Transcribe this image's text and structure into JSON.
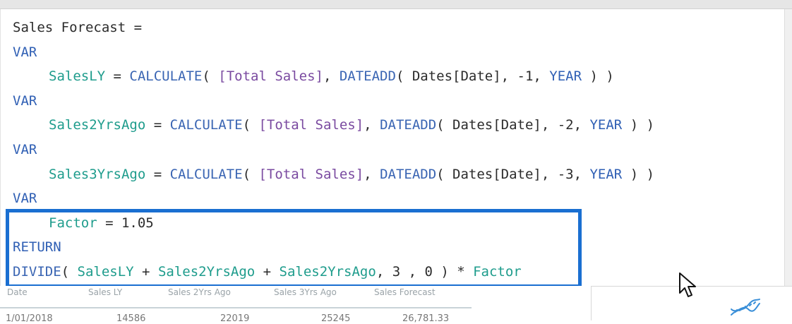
{
  "editor": {
    "lines": [
      {
        "tokens": [
          {
            "t": "Sales Forecast =",
            "c": "plain"
          }
        ]
      },
      {
        "tokens": [
          {
            "t": "VAR",
            "c": "kw"
          }
        ]
      },
      {
        "indent": true,
        "tokens": [
          {
            "t": "SalesLY",
            "c": "var"
          },
          {
            "t": " = ",
            "c": "plain"
          },
          {
            "t": "CALCULATE",
            "c": "fn"
          },
          {
            "t": "( ",
            "c": "plain"
          },
          {
            "t": "[Total Sales]",
            "c": "meas"
          },
          {
            "t": ", ",
            "c": "plain"
          },
          {
            "t": "DATEADD",
            "c": "fn"
          },
          {
            "t": "( Dates[Date], -1, ",
            "c": "plain"
          },
          {
            "t": "YEAR",
            "c": "kw"
          },
          {
            "t": " ) )",
            "c": "plain"
          }
        ]
      },
      {
        "tokens": [
          {
            "t": "VAR",
            "c": "kw"
          }
        ]
      },
      {
        "indent": true,
        "tokens": [
          {
            "t": "Sales2YrsAgo",
            "c": "var"
          },
          {
            "t": " = ",
            "c": "plain"
          },
          {
            "t": "CALCULATE",
            "c": "fn"
          },
          {
            "t": "( ",
            "c": "plain"
          },
          {
            "t": "[Total Sales]",
            "c": "meas"
          },
          {
            "t": ", ",
            "c": "plain"
          },
          {
            "t": "DATEADD",
            "c": "fn"
          },
          {
            "t": "( Dates[Date], -2, ",
            "c": "plain"
          },
          {
            "t": "YEAR",
            "c": "kw"
          },
          {
            "t": " ) )",
            "c": "plain"
          }
        ]
      },
      {
        "tokens": [
          {
            "t": "VAR",
            "c": "kw"
          }
        ]
      },
      {
        "indent": true,
        "tokens": [
          {
            "t": "Sales3YrsAgo",
            "c": "var"
          },
          {
            "t": " = ",
            "c": "plain"
          },
          {
            "t": "CALCULATE",
            "c": "fn"
          },
          {
            "t": "( ",
            "c": "plain"
          },
          {
            "t": "[Total Sales]",
            "c": "meas"
          },
          {
            "t": ", ",
            "c": "plain"
          },
          {
            "t": "DATEADD",
            "c": "fn"
          },
          {
            "t": "( Dates[Date], -3, ",
            "c": "plain"
          },
          {
            "t": "YEAR",
            "c": "kw"
          },
          {
            "t": " ) )",
            "c": "plain"
          }
        ]
      },
      {
        "tokens": [
          {
            "t": "VAR",
            "c": "kw"
          }
        ]
      },
      {
        "indent": true,
        "tokens": [
          {
            "t": "Factor",
            "c": "var"
          },
          {
            "t": " = 1.05",
            "c": "plain"
          }
        ]
      },
      {
        "tokens": [
          {
            "t": "RETURN",
            "c": "kw"
          }
        ]
      },
      {
        "tokens": [
          {
            "t": "DIVIDE",
            "c": "fn"
          },
          {
            "t": "( ",
            "c": "plain"
          },
          {
            "t": "SalesLY",
            "c": "var"
          },
          {
            "t": " + ",
            "c": "plain"
          },
          {
            "t": "Sales2YrsAgo",
            "c": "var"
          },
          {
            "t": " + ",
            "c": "plain"
          },
          {
            "t": "Sales2YrsAgo",
            "c": "var"
          },
          {
            "t": ", 3 , 0 ) * ",
            "c": "plain"
          },
          {
            "t": "Factor",
            "c": "var"
          }
        ]
      }
    ]
  },
  "table": {
    "headers": [
      "Date",
      "Sales LY",
      "Sales 2Yrs Ago",
      "Sales 3Yrs Ago",
      "Sales Forecast"
    ],
    "first_row": [
      "1/01/2018",
      "14586",
      "22019",
      "25245",
      "26,781.33"
    ]
  },
  "icons": {
    "dna": "dna-icon",
    "cursor": "mouse-pointer-icon"
  },
  "colors": {
    "selection": "#1a6fd1",
    "keyword": "#2f5fb4",
    "variable": "#1e9c8c",
    "measure": "#7a4aa0"
  }
}
